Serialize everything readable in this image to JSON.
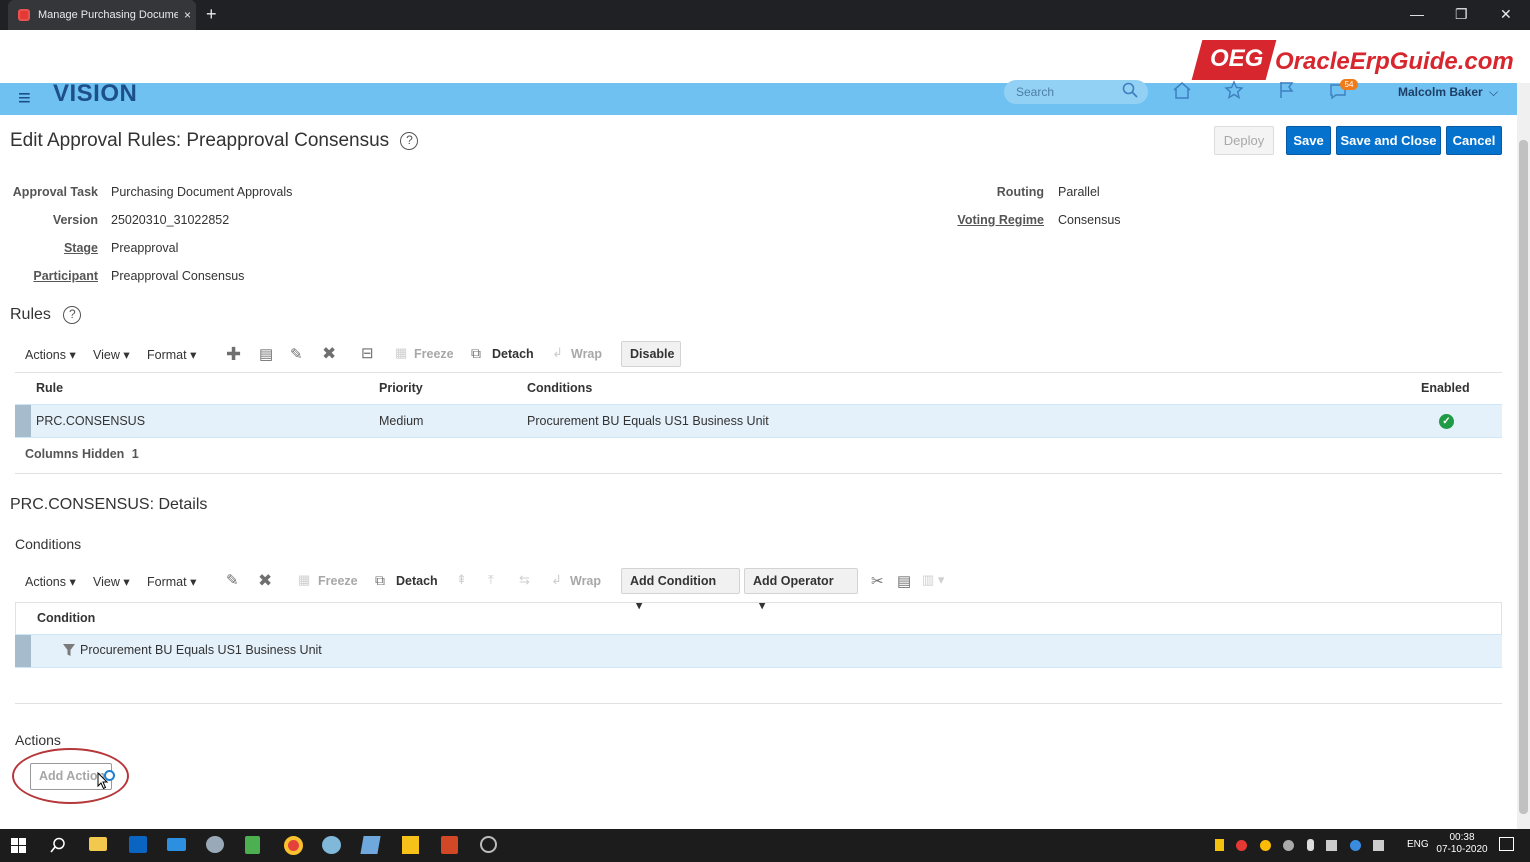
{
  "browser": {
    "tab_title": "Manage Purchasing Document A",
    "tab_close": "×",
    "new_tab": "+",
    "minimize": "—",
    "restore": "❐",
    "close": "✕"
  },
  "brand": {
    "badge": "OEG",
    "name": "OracleErpGuide.com",
    "color": "#d8262e"
  },
  "app_header": {
    "menu_icon": "≡",
    "app_name": "VISION",
    "search_placeholder": "Search",
    "notification_count": "54",
    "user_name": "Malcolm Baker",
    "user_chevron": "⌵",
    "accent_color": "#6ec1f1"
  },
  "page": {
    "title": "Edit Approval Rules: Preapproval Consensus",
    "help": "?",
    "buttons": {
      "deploy": "Deploy",
      "save": "Save",
      "save_and_close": "Save and Close",
      "cancel": "Cancel"
    }
  },
  "fields": {
    "approval_task_label": "Approval Task",
    "approval_task_value": "Purchasing Document Approvals",
    "version_label": "Version",
    "version_value": "25020310_31022852",
    "stage_label": "Stage",
    "stage_value": "Preapproval",
    "participant_label": "Participant",
    "participant_value": "Preapproval Consensus",
    "routing_label": "Routing",
    "routing_value": "Parallel",
    "voting_regime_label": "Voting Regime",
    "voting_regime_value": "Consensus"
  },
  "rules": {
    "title": "Rules",
    "help": "?",
    "toolbar": {
      "actions": "Actions",
      "view": "View",
      "format": "Format",
      "freeze": "Freeze",
      "detach": "Detach",
      "wrap": "Wrap",
      "disable": "Disable"
    },
    "columns": [
      "Rule",
      "Priority",
      "Conditions",
      "Enabled"
    ],
    "rows": [
      {
        "rule": "PRC.CONSENSUS",
        "priority": "Medium",
        "conditions": "Procurement BU Equals US1 Business Unit",
        "enabled": "✓"
      }
    ],
    "columns_hidden_label": "Columns Hidden",
    "columns_hidden_count": "1"
  },
  "details": {
    "title": "PRC.CONSENSUS: Details",
    "conditions": {
      "title": "Conditions",
      "toolbar": {
        "actions": "Actions",
        "view": "View",
        "format": "Format",
        "freeze": "Freeze",
        "detach": "Detach",
        "wrap": "Wrap",
        "add_condition": "Add Condition",
        "add_operator": "Add Operator"
      },
      "column": "Condition",
      "rows": [
        {
          "condition": "Procurement BU Equals US1 Business Unit"
        }
      ]
    },
    "actions": {
      "title": "Actions",
      "add_action": "Add Action"
    }
  },
  "taskbar": {
    "lang": "ENG",
    "time": "00:38",
    "date": "07-10-2020"
  }
}
